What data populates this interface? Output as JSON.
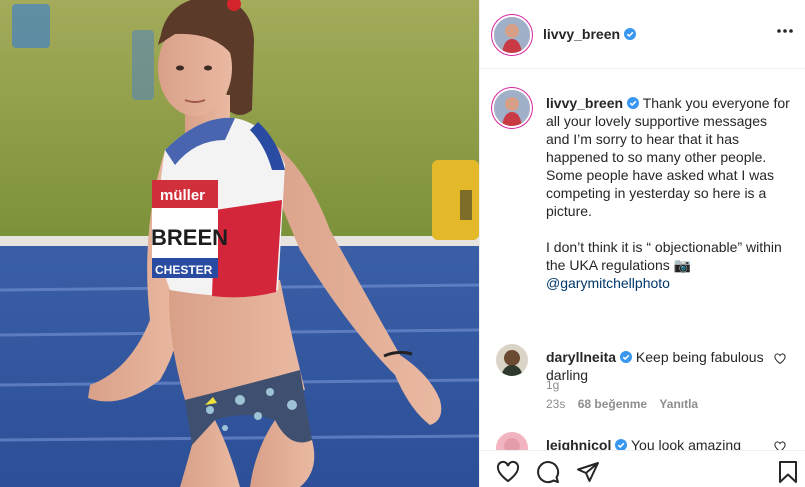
{
  "post": {
    "author": "livvy_breen",
    "verified": true
  },
  "caption": {
    "username": "livvy_breen",
    "paragraph1": "Thank you everyone for all your lovely supportive messages and I’m sorry to hear that it has happened to so many other people. Some people have asked what I was competing in yesterday so here is a picture.",
    "paragraph2": "I don’t think it is “ objectionable” within the UKA regulations 📷",
    "mention": "@garymitchellphoto",
    "time_ago": "1g"
  },
  "comments": [
    {
      "username": "daryllneita",
      "text": "Keep being fabulous darling",
      "time_ago": "23s",
      "likes": "68 beğenme",
      "reply": "Yanıtla"
    },
    {
      "username": "leighnicol",
      "text": "You look amazing"
    }
  ],
  "photo": {
    "bib_brand": "müller",
    "bib_name": "BREEN",
    "bib_city": "CHESTER"
  },
  "icons": {
    "more": "more-options-icon",
    "like": "heart-icon",
    "comment": "comment-icon",
    "share": "share-icon",
    "save": "bookmark-icon"
  },
  "colors": {
    "verified_blue": "#3897f0",
    "story_ring": "#d6249f",
    "mention": "#00376b",
    "muted": "#8e8e8e"
  }
}
